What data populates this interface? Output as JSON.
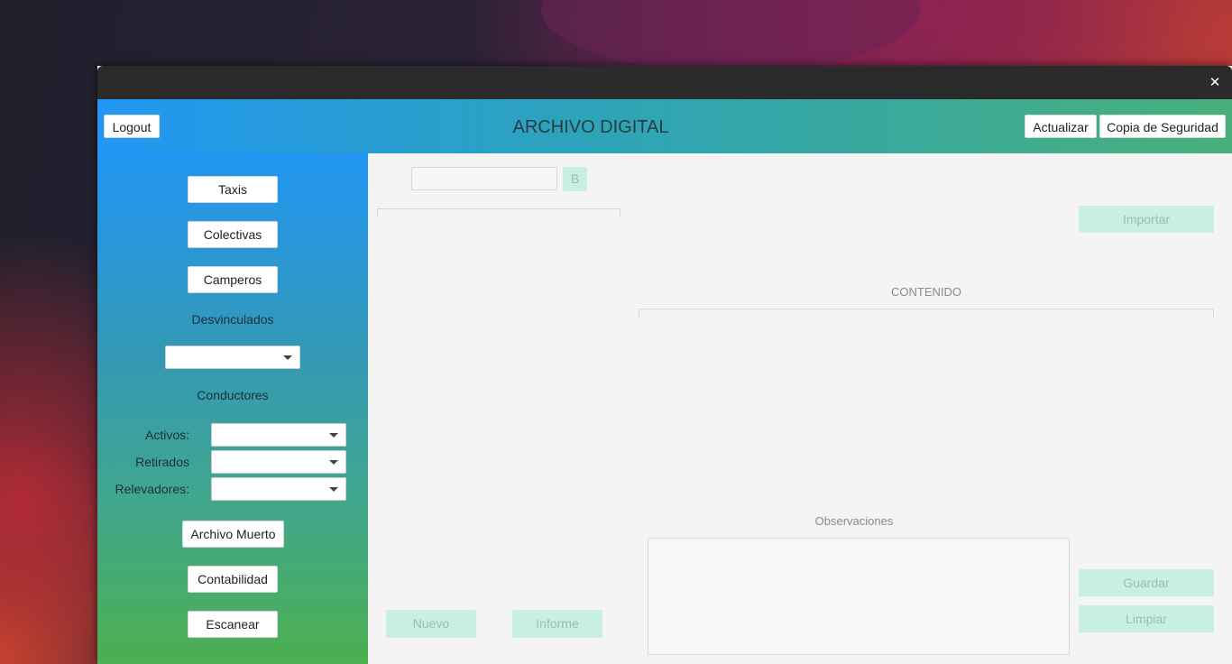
{
  "window": {
    "close_symbol": "✕"
  },
  "header": {
    "title": "ARCHIVO DIGITAL",
    "logout_label": "Logout",
    "refresh_label": "Actualizar",
    "backup_label": "Copia de Seguridad"
  },
  "sidebar": {
    "taxis_label": "Taxis",
    "colectivas_label": "Colectivas",
    "camperos_label": "Camperos",
    "desvinculados_label": "Desvinculados",
    "desvinculados_value": "",
    "conductores_label": "Conductores",
    "activos_label": "Activos:",
    "activos_value": "",
    "retirados_label": "Retirados",
    "retirados_value": "",
    "relevadores_label": "Relevadores:",
    "relevadores_value": "",
    "archivo_muerto_label": "Archivo Muerto",
    "contabilidad_label": "Contabilidad",
    "escanear_label": "Escanear"
  },
  "main": {
    "search_value": "",
    "search_button_label": "B",
    "import_label": "Importar",
    "content_label": "CONTENIDO",
    "observaciones_label": "Observaciones",
    "observaciones_value": "",
    "guardar_label": "Guardar",
    "limpiar_label": "Limpiar",
    "nuevo_label": "Nuevo",
    "informe_label": "Informe"
  },
  "colors": {
    "header_start": "#2196f3",
    "header_end": "#48b07a",
    "sidebar_bottom": "#4caf50",
    "disabled_button": "#c8efe4"
  }
}
